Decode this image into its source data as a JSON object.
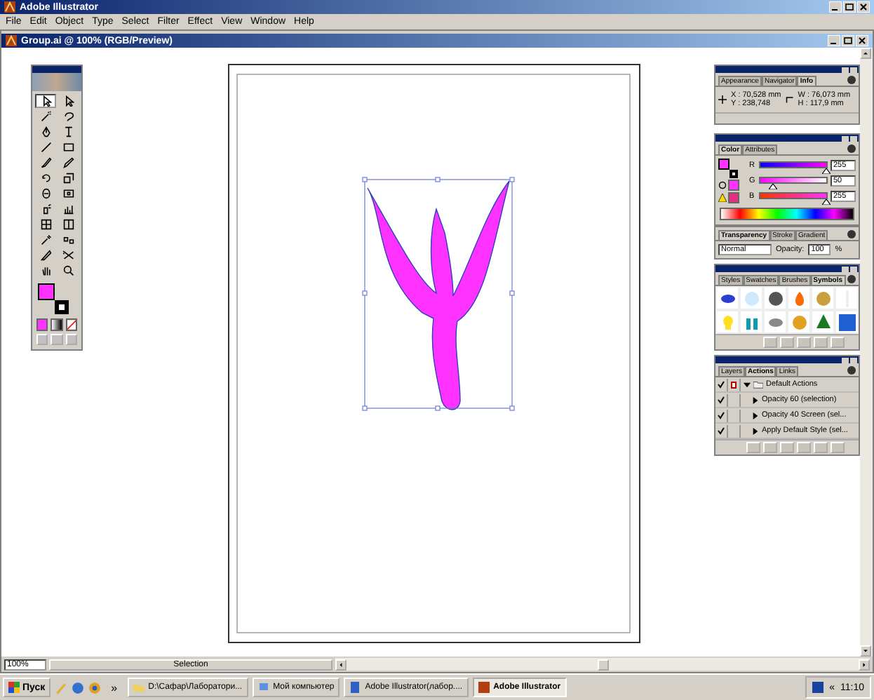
{
  "app": {
    "title": "Adobe Illustrator"
  },
  "menu": [
    "File",
    "Edit",
    "Object",
    "Type",
    "Select",
    "Filter",
    "Effect",
    "View",
    "Window",
    "Help"
  ],
  "document": {
    "title": "Group.ai @ 100% (RGB/Preview)",
    "zoom": "100%",
    "status": "Selection"
  },
  "toolbox": {
    "tools": [
      {
        "kind": "select",
        "selected": true
      },
      {
        "kind": "direct",
        "selected": false
      },
      {
        "kind": "wand",
        "selected": false
      },
      {
        "kind": "lasso",
        "selected": false
      },
      {
        "kind": "pen",
        "selected": false
      },
      {
        "kind": "type",
        "selected": false
      },
      {
        "kind": "line",
        "selected": false
      },
      {
        "kind": "rect",
        "selected": false
      },
      {
        "kind": "brush",
        "selected": false
      },
      {
        "kind": "pencil",
        "selected": false
      },
      {
        "kind": "rotate",
        "selected": false
      },
      {
        "kind": "scale",
        "selected": false
      },
      {
        "kind": "warp",
        "selected": false
      },
      {
        "kind": "transform",
        "selected": false
      },
      {
        "kind": "sprayer",
        "selected": false
      },
      {
        "kind": "graph",
        "selected": false
      },
      {
        "kind": "mesh",
        "selected": false
      },
      {
        "kind": "gradient",
        "selected": false
      },
      {
        "kind": "eyedropper",
        "selected": false
      },
      {
        "kind": "blend",
        "selected": false
      },
      {
        "kind": "knife",
        "selected": false
      },
      {
        "kind": "scissors",
        "selected": false
      },
      {
        "kind": "hand",
        "selected": false
      },
      {
        "kind": "zoom",
        "selected": false
      }
    ]
  },
  "info_panel": {
    "tabs": [
      {
        "label": "Appearance",
        "selected": false
      },
      {
        "label": "Navigator",
        "selected": false
      },
      {
        "label": "Info",
        "selected": true
      }
    ],
    "x": "X : 70,528 mm",
    "y": "Y : 238,748",
    "w": "W : 76,073 mm",
    "h": "H : 117,9 mm"
  },
  "color_panel": {
    "tabs": [
      {
        "label": "Color",
        "selected": true
      },
      {
        "label": "Attributes",
        "selected": false
      }
    ],
    "channels": [
      {
        "name": "R",
        "value": "255",
        "level": 1
      },
      {
        "name": "G",
        "value": "50",
        "level": 0.2
      },
      {
        "name": "B",
        "value": "255",
        "level": 1
      }
    ]
  },
  "transparency_panel": {
    "tabs": [
      {
        "label": "Transparency",
        "selected": true
      },
      {
        "label": "Stroke",
        "selected": false
      },
      {
        "label": "Gradient",
        "selected": false
      }
    ],
    "blend_mode": "Normal",
    "opacity_label": "Opacity:",
    "opacity": "100",
    "unit": "%"
  },
  "symbols_panel": {
    "tabs": [
      {
        "label": "Styles",
        "selected": false
      },
      {
        "label": "Swatches",
        "selected": false
      },
      {
        "label": "Brushes",
        "selected": false
      },
      {
        "label": "Symbols",
        "selected": true
      }
    ]
  },
  "actions_panel": {
    "tabs": [
      {
        "label": "Layers",
        "selected": false
      },
      {
        "label": "Actions",
        "selected": true
      },
      {
        "label": "Links",
        "selected": false
      }
    ],
    "items": [
      {
        "kind": "set",
        "label": "Default Actions",
        "checked": true
      },
      {
        "kind": "action",
        "label": "Opacity 60 (selection)",
        "checked": true
      },
      {
        "kind": "action",
        "label": "Opacity 40 Screen (sel...",
        "checked": true
      },
      {
        "kind": "action",
        "label": "Apply Default Style (sel...",
        "checked": true
      }
    ]
  },
  "taskbar": {
    "start": "Пуск",
    "quick_more": "»",
    "buttons": [
      {
        "label": "D:\\Сафар\\Лаборатори...",
        "kind": "folder",
        "selected": false
      },
      {
        "label": "Мой компьютер",
        "kind": "computer",
        "selected": false
      },
      {
        "label": "Adobe Illustrator(лабор....",
        "kind": "document",
        "selected": false
      },
      {
        "label": "Adobe Illustrator",
        "kind": "app",
        "selected": true
      }
    ],
    "tray_arrow": "«",
    "clock": "11:10"
  }
}
